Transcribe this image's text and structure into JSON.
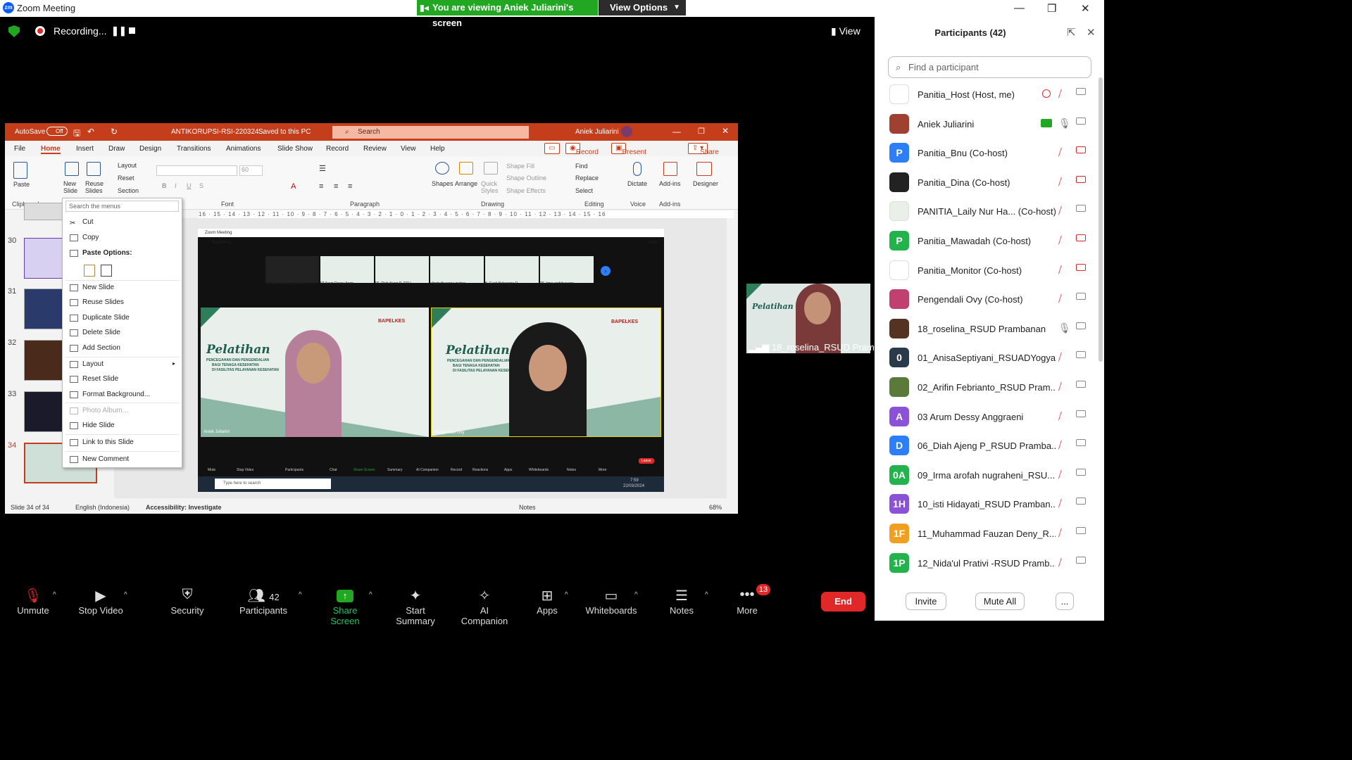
{
  "window": {
    "title": "Zoom Meeting",
    "logo": "zm"
  },
  "banner": {
    "viewing": "You are viewing Aniek Juliarini's screen",
    "view_options": "View Options"
  },
  "recording": {
    "label": "Recording..."
  },
  "top_view": "View",
  "ppt": {
    "autosave": "AutoSave",
    "autosave_state": "Off",
    "filename": "ANTIKORUPSI-RSI-220324...",
    "saved": "Saved to this PC",
    "search": "Search",
    "user": "Aniek Juliarini",
    "menu": [
      "File",
      "Home",
      "Insert",
      "Draw",
      "Design",
      "Transitions",
      "Animations",
      "Slide Show",
      "Record",
      "Review",
      "View",
      "Help"
    ],
    "record_btn": "Record",
    "present_btn": "Present in Teams",
    "share_btn": "Share",
    "ribbon": {
      "paste": "Paste",
      "new_slide": "New Slide",
      "reuse": "Reuse Slides",
      "layout": "Layout",
      "reset": "Reset",
      "section": "Section",
      "font_size": "60",
      "shapes": "Shapes",
      "arrange": "Arrange",
      "quick_styles": "Quick Styles",
      "shape_fill": "Shape Fill",
      "shape_outline": "Shape Outline",
      "shape_effects": "Shape Effects",
      "find": "Find",
      "replace": "Replace",
      "select": "Select",
      "dictate": "Dictate",
      "addins": "Add-ins",
      "designer": "Designer",
      "groups": [
        "Clipboard",
        "Font",
        "Paragraph",
        "Drawing",
        "Editing",
        "Voice",
        "Add-ins"
      ]
    },
    "ruler": "16 · 15 · 14 · 13 · 12 · 11 · 10 · 9 · 8 · 7 · 6 · 5 · 4 · 3 · 2 · 1 · 0 · 1 · 2 · 3 · 4 · 5 · 6 · 7 · 8 · 9 · 10 · 11 · 12 · 13 · 14 · 15 · 16",
    "thumbs": [
      "30",
      "31",
      "32",
      "33",
      "34"
    ],
    "status": {
      "slide": "Slide 34 of 34",
      "lang": "English (Indonesia)",
      "access": "Accessibility: Investigate",
      "notes": "Notes",
      "zoom": "68%"
    }
  },
  "context_menu": {
    "search": "Search the menus",
    "items": [
      "Cut",
      "Copy",
      "Paste Options:",
      "New Slide",
      "Reuse Slides",
      "Duplicate Slide",
      "Delete Slide",
      "Add Section",
      "Layout",
      "Reset Slide",
      "Format Background...",
      "Photo Album...",
      "Hide Slide",
      "Link to this Slide",
      "New Comment"
    ]
  },
  "shared_slide": {
    "title": "Zoom Meeting",
    "recording": "Recording",
    "view": "View",
    "thumb_names": [
      "02_Arifin Febrianto_RSU...",
      "03 Arum Dessy Angg...",
      "06_Diah Ajeng P_RSU...",
      "elizabeth ronna mahar...",
      "8_Gusti Nakasone R...",
      "09_Irma arofah nugra..."
    ],
    "pelatihan": "Pelatihan",
    "subtitle": "PENCEGAHAN DAN PENGENDALIAN",
    "subtitle2": "BAGI TENAGA KESEHATAN",
    "subtitle3": "DI FASILITAS PELAYANAN KESEHATAN",
    "bapelkes": "BAPELKES",
    "left_name": "Aniek Juliarini",
    "right_name": "Pengendali Ovy",
    "toolbar": [
      "Mute",
      "Stop Video",
      "Participants",
      "Chat",
      "Share Screen",
      "Summary",
      "AI Companion",
      "Record",
      "Reactions",
      "Apps",
      "Whiteboards",
      "Notes",
      "More"
    ],
    "leave": "Leave",
    "taskbar_search": "Type here to search",
    "time": "7:59",
    "date": "22/03/2024"
  },
  "pip": {
    "name": "18_roselina_RSUD Pram..."
  },
  "panel": {
    "title": "Participants (42)",
    "find_placeholder": "Find a participant",
    "participants": [
      {
        "name": "Panitia_Host (Host, me)",
        "initials": "",
        "color": "#ffffff",
        "mic": "muted",
        "cam": "off"
      },
      {
        "name": "Aniek Juliarini",
        "initials": "",
        "color": "#a04030",
        "mic": "on",
        "cam": "on"
      },
      {
        "name": "Panitia_Bnu (Co-host)",
        "initials": "P",
        "color": "#2d7ff9",
        "mic": "muted",
        "cam": "muted"
      },
      {
        "name": "Panitia_Dina (Co-host)",
        "initials": "",
        "color": "#222222",
        "mic": "muted",
        "cam": "muted"
      },
      {
        "name": "PANITIA_Laily Nur Ha...  (Co-host)",
        "initials": "",
        "color": "#e8f0e8",
        "mic": "muted",
        "cam": "on"
      },
      {
        "name": "Panitia_Mawadah (Co-host)",
        "initials": "P",
        "color": "#22b34c",
        "mic": "muted",
        "cam": "muted"
      },
      {
        "name": "Panitia_Monitor (Co-host)",
        "initials": "",
        "color": "#ffffff",
        "mic": "muted",
        "cam": "muted"
      },
      {
        "name": "Pengendali Ovy (Co-host)",
        "initials": "",
        "color": "#c04070",
        "mic": "muted",
        "cam": "on"
      },
      {
        "name": "18_roselina_RSUD Prambanan",
        "initials": "",
        "color": "#553322",
        "mic": "on",
        "cam": "on"
      },
      {
        "name": "01_AnisaSeptiyani_RSUADYogya...",
        "initials": "0",
        "color": "#2b3a4a",
        "mic": "muted",
        "cam": "on"
      },
      {
        "name": "02_Arifin Febrianto_RSUD Pram...",
        "initials": "",
        "color": "#5a7a3a",
        "mic": "muted",
        "cam": "on"
      },
      {
        "name": "03 Arum Dessy Anggraeni",
        "initials": "A",
        "color": "#8a52d6",
        "mic": "muted",
        "cam": "on"
      },
      {
        "name": "06_Diah Ajeng P_RSUD Pramba...",
        "initials": "D",
        "color": "#2d7ff9",
        "mic": "muted",
        "cam": "on"
      },
      {
        "name": "09_Irma arofah nugraheni_RSU...",
        "initials": "0A",
        "color": "#22b34c",
        "mic": "muted",
        "cam": "on"
      },
      {
        "name": "10_isti Hidayati_RSUD Pramban...",
        "initials": "1H",
        "color": "#8a52d6",
        "mic": "muted",
        "cam": "on"
      },
      {
        "name": "11_Muhammad Fauzan Deny_R...",
        "initials": "1F",
        "color": "#f0a020",
        "mic": "muted",
        "cam": "on"
      },
      {
        "name": "12_Nida'ul Prativi -RSUD Pramb...",
        "initials": "1P",
        "color": "#22b34c",
        "mic": "muted",
        "cam": "on"
      }
    ],
    "invite": "Invite",
    "mute_all": "Mute All",
    "more": "..."
  },
  "toolbar": {
    "unmute": "Unmute",
    "stop_video": "Stop Video",
    "security": "Security",
    "participants": "Participants",
    "participants_count": "42",
    "share": "Share Screen",
    "summary": "Start Summary",
    "ai": "AI Companion",
    "apps": "Apps",
    "whiteboards": "Whiteboards",
    "notes": "Notes",
    "more": "More",
    "more_badge": "13",
    "end": "End"
  },
  "colors": {
    "zoom_green": "#22a722",
    "ppt_red": "#c43e1c",
    "end_red": "#e02828",
    "zoom_blue": "#0b5cff"
  }
}
